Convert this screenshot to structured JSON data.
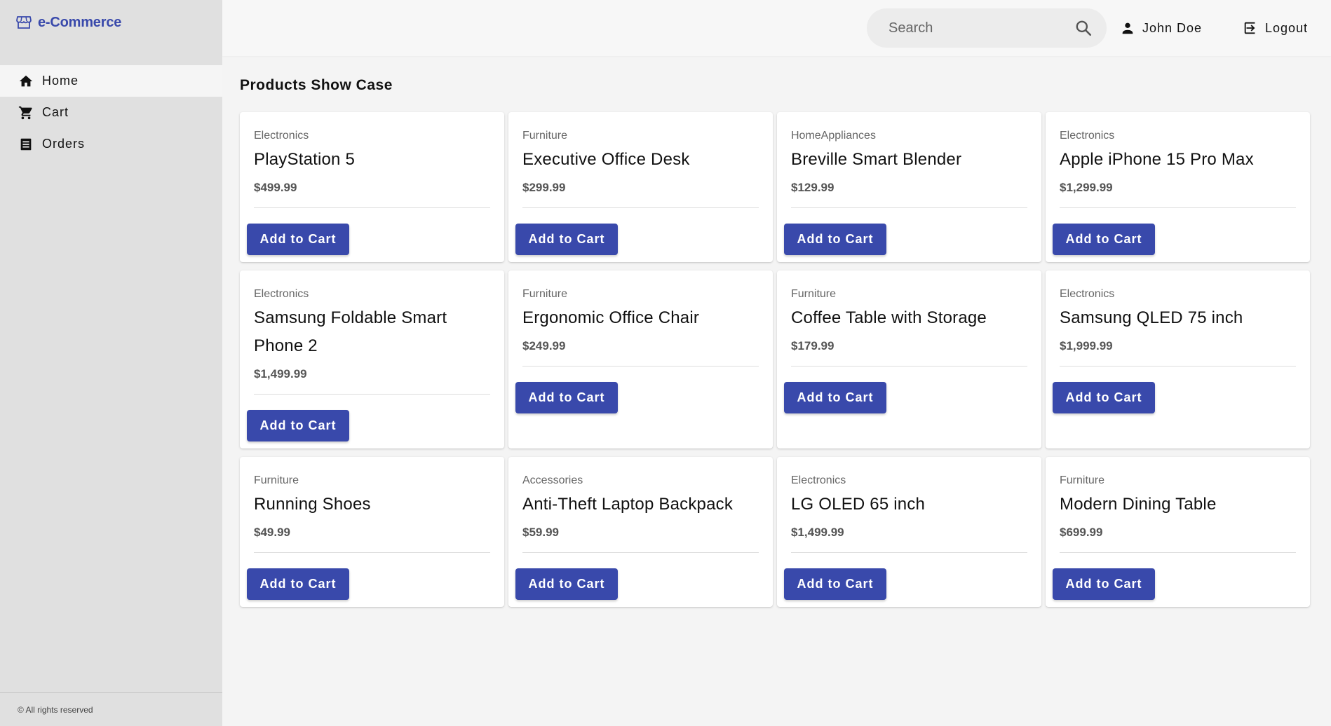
{
  "brand": {
    "name": "e-Commerce",
    "icon": "storefront-icon",
    "color": "#3949ab"
  },
  "nav": [
    {
      "label": "Home",
      "icon": "home-icon",
      "active": true
    },
    {
      "label": "Cart",
      "icon": "cart-icon",
      "active": false
    },
    {
      "label": "Orders",
      "icon": "orders-icon",
      "active": false
    }
  ],
  "footer": {
    "text": "© All rights reserved"
  },
  "topbar": {
    "search_placeholder": "Search",
    "user_name": "John Doe",
    "logout_label": "Logout"
  },
  "page_title": "Products Show Case",
  "products": [
    {
      "category": "Electronics",
      "name": "PlayStation 5",
      "price": "$499.99",
      "button": "Add to Cart"
    },
    {
      "category": "Furniture",
      "name": "Executive Office Desk",
      "price": "$299.99",
      "button": "Add to Cart"
    },
    {
      "category": "HomeAppliances",
      "name": "Breville Smart Blender",
      "price": "$129.99",
      "button": "Add to Cart"
    },
    {
      "category": "Electronics",
      "name": "Apple iPhone 15 Pro Max",
      "price": "$1,299.99",
      "button": "Add to Cart"
    },
    {
      "category": "Electronics",
      "name": "Samsung Foldable Smart Phone 2",
      "price": "$1,499.99",
      "button": "Add to Cart"
    },
    {
      "category": "Furniture",
      "name": "Ergonomic Office Chair",
      "price": "$249.99",
      "button": "Add to Cart"
    },
    {
      "category": "Furniture",
      "name": "Coffee Table with Storage",
      "price": "$179.99",
      "button": "Add to Cart"
    },
    {
      "category": "Electronics",
      "name": "Samsung QLED 75 inch",
      "price": "$1,999.99",
      "button": "Add to Cart"
    },
    {
      "category": "Furniture",
      "name": "Running Shoes",
      "price": "$49.99",
      "button": "Add to Cart"
    },
    {
      "category": "Accessories",
      "name": "Anti-Theft Laptop Backpack",
      "price": "$59.99",
      "button": "Add to Cart"
    },
    {
      "category": "Electronics",
      "name": "LG OLED 65 inch",
      "price": "$1,499.99",
      "button": "Add to Cart"
    },
    {
      "category": "Furniture",
      "name": "Modern Dining Table",
      "price": "$699.99",
      "button": "Add to Cart"
    }
  ],
  "colors": {
    "accent": "#3949ab",
    "sidebar_bg": "#e0e0e0",
    "page_bg": "#f4f4f4"
  }
}
